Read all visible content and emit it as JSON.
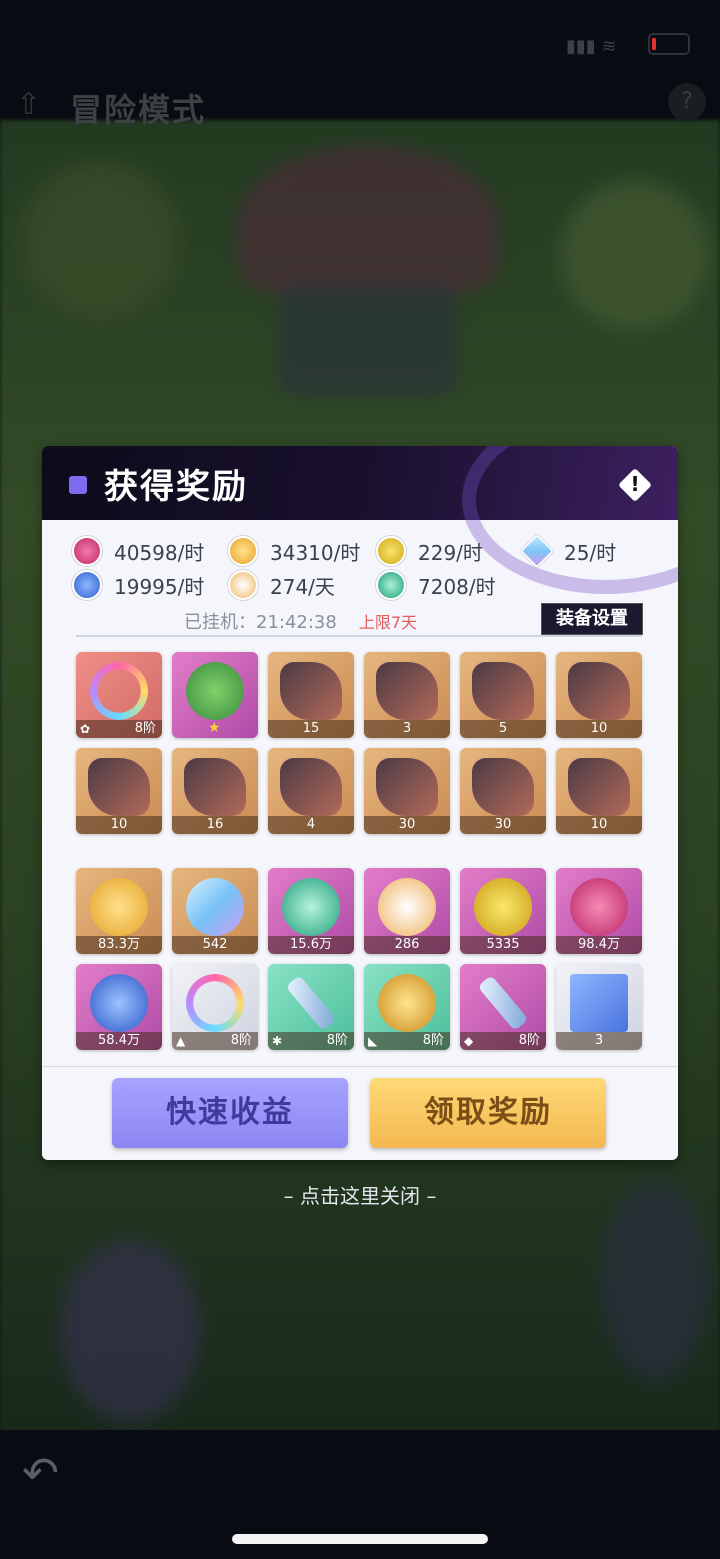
{
  "top_bar": {
    "title": "冒险模式",
    "back_icon": "arrow-up-icon",
    "help_icon": "question-icon"
  },
  "modal": {
    "title": "获得奖励",
    "rates": [
      {
        "icon": "pink-crystal-icon",
        "color": "#d6397e",
        "text": "40598/时"
      },
      {
        "icon": "gold-coin-icon",
        "color": "#f0b43a",
        "text": "34310/时"
      },
      {
        "icon": "sword-token-icon",
        "color": "#e6c426",
        "text": "229/时"
      },
      {
        "icon": "diamond-icon",
        "color": "#7ec6f5",
        "text": "25/时"
      },
      {
        "icon": "blue-helmet-icon",
        "color": "#2f6fe0",
        "text": "19995/时"
      },
      {
        "icon": "star-orb-icon",
        "color": "#f6c46e",
        "text": "274/天"
      },
      {
        "icon": "temple-token-icon",
        "color": "#2fbf91",
        "text": "7208/时"
      }
    ],
    "hang_label": "已挂机：21:42:38",
    "limit_label": "上限7天",
    "equip_button": "装备设置",
    "items_row1": [
      {
        "name": "rainbow-ring-item",
        "bg": "salmon",
        "count": "8阶",
        "mark": "✿"
      },
      {
        "name": "green-badge-item",
        "bg": "pink",
        "count": "",
        "star": "★"
      },
      {
        "name": "hero-shard-item",
        "bg": "tan",
        "count": "15"
      },
      {
        "name": "hero-shard-item",
        "bg": "tan",
        "count": "3"
      },
      {
        "name": "hero-shard-item",
        "bg": "tan",
        "count": "5"
      },
      {
        "name": "hero-shard-item",
        "bg": "tan",
        "count": "10"
      }
    ],
    "items_row2": [
      {
        "name": "hero-shard-item",
        "bg": "tan",
        "count": "10"
      },
      {
        "name": "hero-shard-item",
        "bg": "tan",
        "count": "16"
      },
      {
        "name": "hero-shard-item",
        "bg": "tan",
        "count": "4"
      },
      {
        "name": "hero-shard-item",
        "bg": "tan",
        "count": "30"
      },
      {
        "name": "hero-shard-item",
        "bg": "tan",
        "count": "30"
      },
      {
        "name": "hero-shard-item",
        "bg": "tan",
        "count": "10"
      }
    ],
    "items_row3": [
      {
        "name": "gold-coin-item",
        "bg": "tan",
        "count": "83.3万"
      },
      {
        "name": "diamond-item",
        "bg": "tan",
        "count": "542"
      },
      {
        "name": "temple-token-item",
        "bg": "pink",
        "count": "15.6万"
      },
      {
        "name": "star-orb-item",
        "bg": "pink",
        "count": "286"
      },
      {
        "name": "sword-token-item",
        "bg": "pink",
        "count": "5335"
      },
      {
        "name": "pink-crystal-item",
        "bg": "pink",
        "count": "98.4万"
      }
    ],
    "items_row4": [
      {
        "name": "blue-helmet-item",
        "bg": "pink",
        "count": "58.4万"
      },
      {
        "name": "rainbow-ring-item",
        "bg": "white",
        "count": "8阶",
        "mark": "▲"
      },
      {
        "name": "sword-item",
        "bg": "green",
        "count": "8阶",
        "mark": "✱"
      },
      {
        "name": "golden-helmet-item",
        "bg": "green",
        "count": "8阶",
        "mark": "◣"
      },
      {
        "name": "sword-item",
        "bg": "pink",
        "count": "8阶",
        "mark": "◆"
      },
      {
        "name": "blue-cubes-item",
        "bg": "white",
        "count": "3"
      }
    ],
    "fast_button": "快速收益",
    "claim_button": "领取奖励"
  },
  "close_hint": "– 点击这里关闭 –"
}
